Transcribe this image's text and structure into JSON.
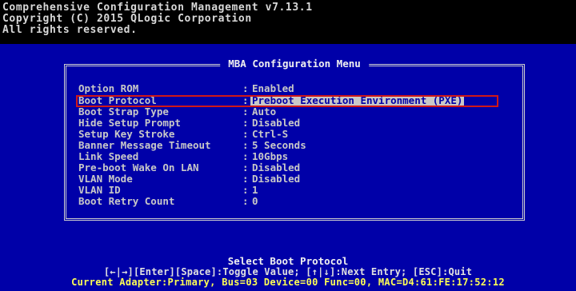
{
  "header": {
    "line1": "Comprehensive Configuration Management v7.13.1",
    "line2": "Copyright (C) 2015 QLogic Corporation",
    "line3": "All rights reserved."
  },
  "menu": {
    "title": "MBA Configuration Menu",
    "separator": ":",
    "items": [
      {
        "label": "Option ROM",
        "value": "Enabled"
      },
      {
        "label": "Boot Protocol",
        "value": "Preboot Execution Environment (PXE)"
      },
      {
        "label": "Boot Strap Type",
        "value": "Auto"
      },
      {
        "label": "Hide Setup Prompt",
        "value": "Disabled"
      },
      {
        "label": "Setup Key Stroke",
        "value": "Ctrl-S"
      },
      {
        "label": "Banner Message Timeout",
        "value": "5 Seconds"
      },
      {
        "label": "Link Speed",
        "value": "10Gbps"
      },
      {
        "label": "Pre-boot Wake On LAN",
        "value": "Disabled"
      },
      {
        "label": "VLAN Mode",
        "value": "Disabled"
      },
      {
        "label": "VLAN ID",
        "value": "1"
      },
      {
        "label": "Boot Retry Count",
        "value": "0"
      }
    ]
  },
  "footer": {
    "help_title": "Select Boot Protocol",
    "keys": "[←|→][Enter][Space]:Toggle Value; [↑|↓]:Next Entry; [ESC]:Quit",
    "adapter": "Current Adapter:Primary, Bus=03 Device=00 Func=00, MAC=D4:61:FE:17:52:12"
  },
  "colors": {
    "background": "#0000a8",
    "header_background": "#000000",
    "text": "#c8c8c8",
    "highlight_frame": "#d01818",
    "adapter_text": "#ffff55"
  }
}
